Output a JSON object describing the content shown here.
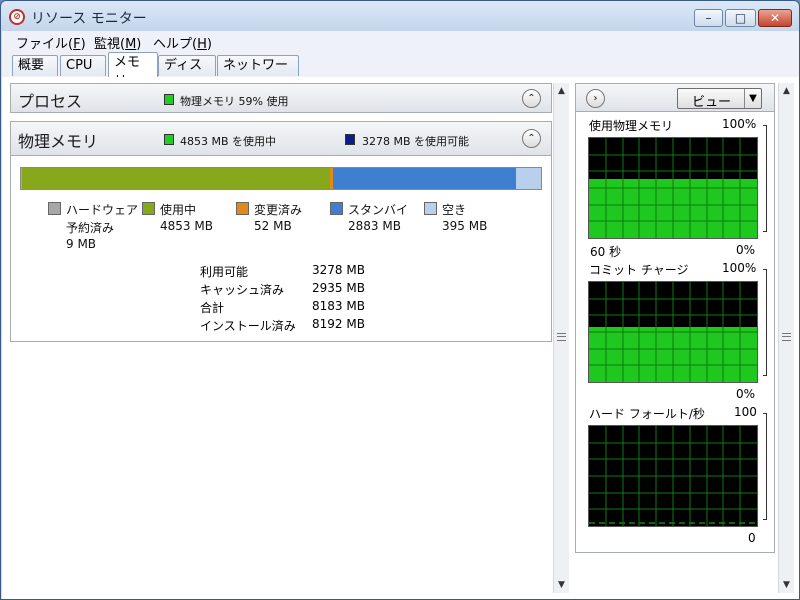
{
  "window": {
    "title": "リソース モニター",
    "minimize": "–",
    "maximize": "□",
    "close": "✕"
  },
  "menu": [
    {
      "text": "ファイル(",
      "key": "F",
      "tail": ")"
    },
    {
      "text": "監視(",
      "key": "M",
      "tail": ")"
    },
    {
      "text": "ヘルプ(",
      "key": "H",
      "tail": ")"
    }
  ],
  "tabs": [
    "概要",
    "CPU",
    "メモリ",
    "ディスク",
    "ネットワーク"
  ],
  "active_tab": "メモリ",
  "process_section": {
    "title": "プロセス",
    "summary": "物理メモリ 59% 使用",
    "summary_color": "#22cc22"
  },
  "memory_section": {
    "title": "物理メモリ",
    "in_use_summary": "4853 MB を使用中",
    "in_use_color": "#22cc22",
    "available_summary": "3278 MB を使用可能",
    "available_color": "#0a1e8c",
    "bar_mb": {
      "hardware_reserved": 9,
      "in_use": 4853,
      "modified": 52,
      "standby": 2883,
      "free": 395
    },
    "legend": [
      {
        "label": "ハードウェア",
        "label2": "予約済み",
        "value": "9 MB",
        "color": "#a8a8a8"
      },
      {
        "label": "使用中",
        "value": "4853 MB",
        "color": "#86a81a"
      },
      {
        "label": "変更済み",
        "value": "52 MB",
        "color": "#e08a1c"
      },
      {
        "label": "スタンバイ",
        "value": "2883 MB",
        "color": "#3f7fcf"
      },
      {
        "label": "空き",
        "value": "395 MB",
        "color": "#b8d0ec"
      }
    ],
    "stats": [
      {
        "label": "利用可能",
        "value": "3278 MB"
      },
      {
        "label": "キャッシュ済み",
        "value": "2935 MB"
      },
      {
        "label": "合計",
        "value": "8183 MB"
      },
      {
        "label": "インストール済み",
        "value": "8192 MB"
      }
    ]
  },
  "right_pane": {
    "expand_icon": "chevron-right-icon",
    "view_label": "ビュー",
    "graphs": [
      {
        "title": "使用物理メモリ",
        "max": "100%",
        "bottom_left": "60 秒",
        "min": "0%",
        "fill_fraction": 0.59
      },
      {
        "title": "コミット チャージ",
        "max": "100%",
        "bottom_left": "",
        "min": "0%",
        "fill_fraction": 0.55
      },
      {
        "title": "ハード フォールト/秒",
        "max": "100",
        "bottom_left": "",
        "min": "0",
        "fill_fraction": 0.02
      }
    ],
    "graph_color": "#1ec81e",
    "grid_color": "#0f7a0f"
  }
}
